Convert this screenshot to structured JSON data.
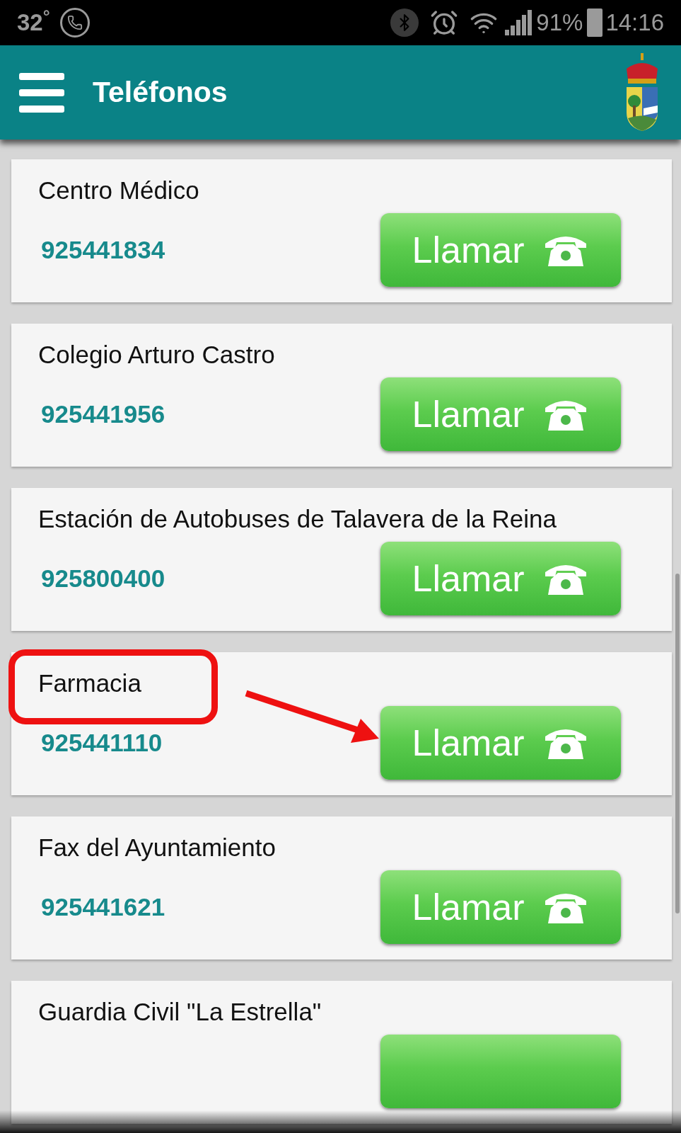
{
  "status_bar": {
    "temperature": "32$^{°}$",
    "battery": "91%",
    "time": "14:16"
  },
  "app_bar": {
    "title": "Teléfonos"
  },
  "contacts": [
    {
      "name": "Centro Médico",
      "phone": "925441834",
      "button": "Llamar",
      "highlighted": false
    },
    {
      "name": "Colegio Arturo Castro",
      "phone": "925441956",
      "button": "Llamar",
      "highlighted": false
    },
    {
      "name": "Estación de Autobuses de Talavera de la Reina",
      "phone": "925800400",
      "button": "Llamar",
      "highlighted": false
    },
    {
      "name": "Farmacia",
      "phone": "925441110",
      "button": "Llamar",
      "highlighted": true
    },
    {
      "name": "Fax del Ayuntamiento",
      "phone": "925441621",
      "button": "Llamar",
      "highlighted": false
    },
    {
      "name": "Guardia Civil \"La Estrella\"",
      "highlighted": false
    }
  ]
}
